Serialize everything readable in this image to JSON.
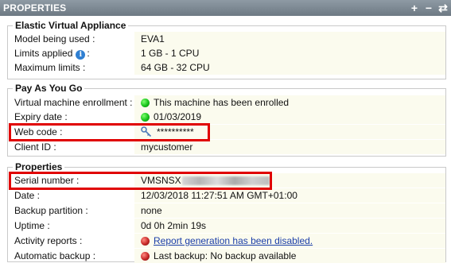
{
  "header": {
    "title": "PROPERTIES",
    "tools": {
      "add": "+",
      "remove": "−",
      "refresh": "⇄"
    }
  },
  "sections": {
    "eva": {
      "legend": "Elastic Virtual Appliance",
      "rows": [
        {
          "label": "Model being used :",
          "value": "EVA1"
        },
        {
          "label": "Limits applied",
          "label_suffix": ":",
          "value": "1 GB - 1 CPU"
        },
        {
          "label": "Maximum limits :",
          "value": "64 GB - 32 CPU"
        }
      ]
    },
    "payg": {
      "legend": "Pay As You Go",
      "rows": [
        {
          "label": "Virtual machine enrollment :",
          "value": "This machine has been enrolled",
          "status": "green"
        },
        {
          "label": "Expiry date :",
          "value": "01/03/2019",
          "status": "green"
        },
        {
          "label": "Web code :",
          "value": "**********"
        },
        {
          "label": "Client ID :",
          "value": "mycustomer"
        }
      ]
    },
    "props": {
      "legend": "Properties",
      "rows": [
        {
          "label": "Serial number :",
          "value": "VMSNSX"
        },
        {
          "label": "Date :",
          "value": "12/03/2018 11:27:51 AM GMT+01:00"
        },
        {
          "label": "Backup partition :",
          "value": "none"
        },
        {
          "label": "Uptime :",
          "value": "0d 0h 2min 19s"
        },
        {
          "label": "Activity reports :",
          "value": "Report generation has been disabled.",
          "status": "red"
        },
        {
          "label": "Automatic backup :",
          "value": "Last backup: No backup available",
          "status": "red"
        }
      ]
    }
  },
  "colors": {
    "header_bg": "#7b8791",
    "value_bg": "#fbfbee",
    "highlight": "#e00000",
    "link": "#1b3ea8"
  }
}
